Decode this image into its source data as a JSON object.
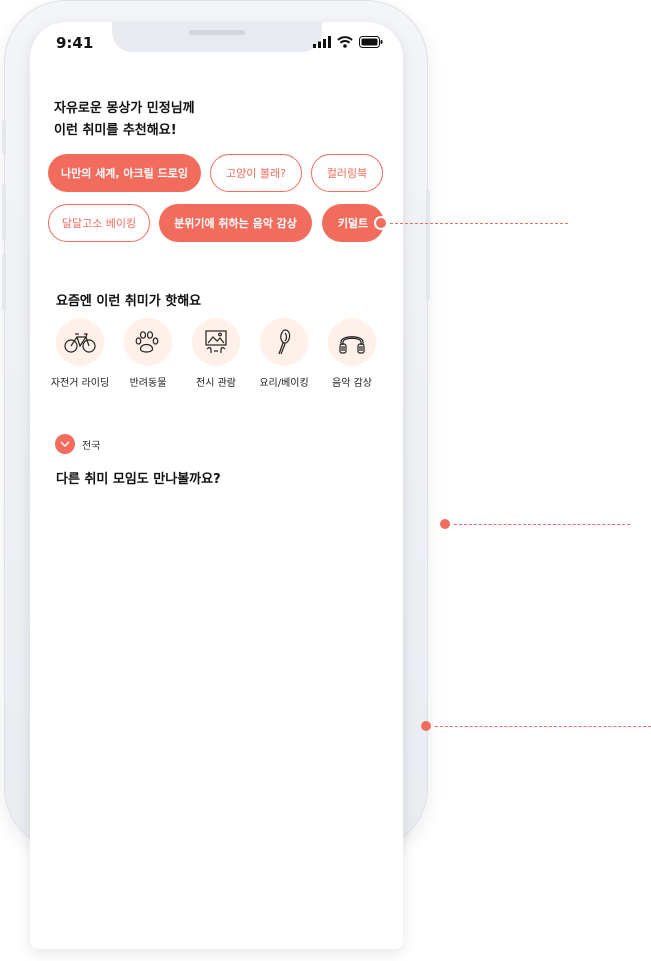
{
  "status": {
    "time": "9:41"
  },
  "recommend": {
    "title_line1": "자유로운 몽상가 민정님께",
    "title_line2": "이런 취미를 추천해요!",
    "chips": [
      {
        "label": "나만의 세계, 아크릴 드로잉",
        "style": "filled"
      },
      {
        "label": "고양이 볼래?",
        "style": "outline"
      },
      {
        "label": "컬러링북",
        "style": "outline"
      },
      {
        "label": "달달고소 베이킹",
        "style": "outline"
      },
      {
        "label": "분위기에 취하는 음악 감상",
        "style": "filled"
      },
      {
        "label": "키덜트",
        "style": "filled"
      }
    ]
  },
  "trending": {
    "title": "요즘엔 이런 취미가 핫해요",
    "categories": [
      {
        "label": "자전거 라이딩",
        "icon": "bicycle-icon"
      },
      {
        "label": "반려동물",
        "icon": "paw-icon"
      },
      {
        "label": "전시 관람",
        "icon": "gallery-icon"
      },
      {
        "label": "요리/베이킹",
        "icon": "whisk-icon"
      },
      {
        "label": "음악 감상",
        "icon": "headphones-icon"
      }
    ]
  },
  "region": {
    "label": "전국",
    "icon": "chevron-down-icon"
  },
  "other": {
    "title": "다른 취미 모임도 만나볼까요?"
  },
  "colors": {
    "accent": "#f26c5d",
    "icon_bg": "#fff1ea"
  }
}
